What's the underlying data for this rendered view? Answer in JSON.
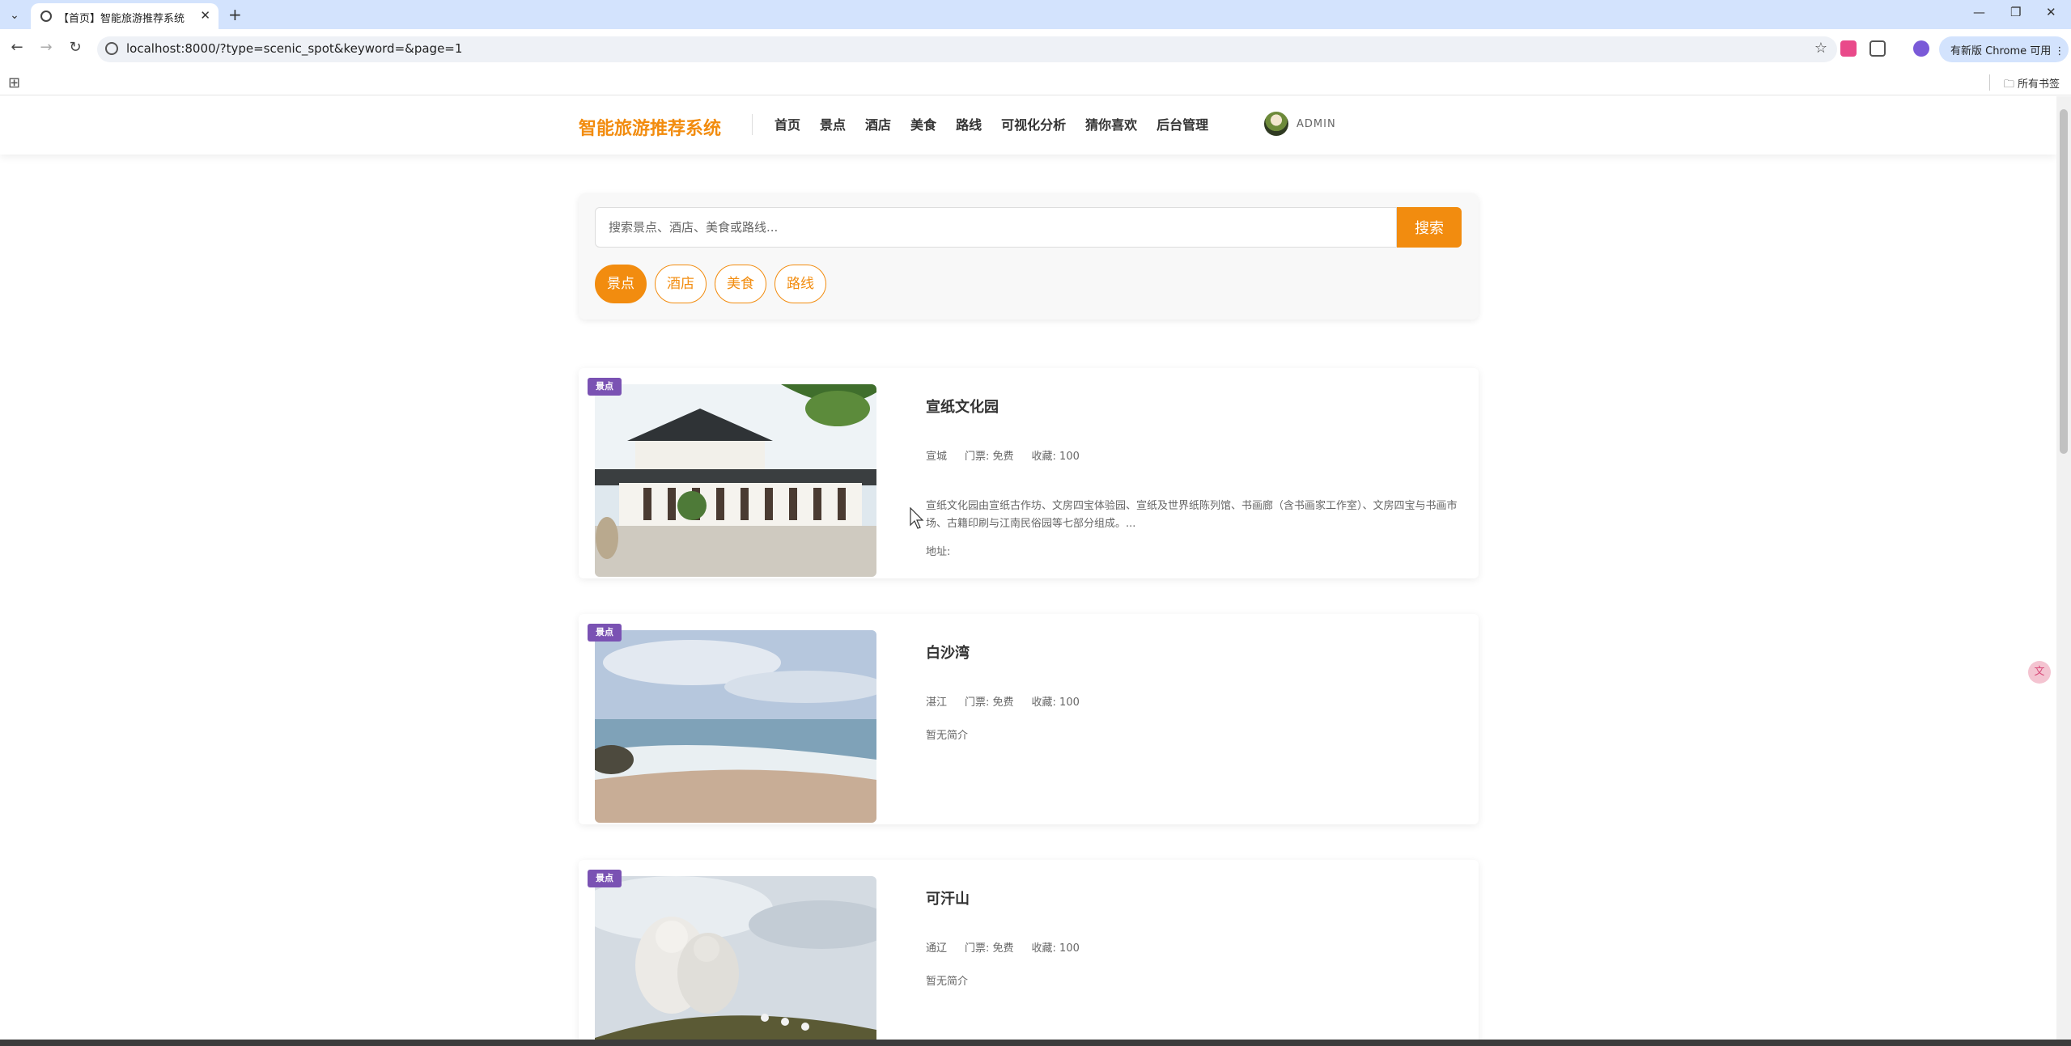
{
  "browser": {
    "tab_title": "【首页】智能旅游推荐系统",
    "url": "localhost:8000/?type=scenic_spot&keyword=&page=1",
    "update_label": "有新版 Chrome 可用",
    "all_bookmarks": "所有书签",
    "icons": [
      "tab-search-icon",
      "back-icon",
      "forward-icon",
      "reload-icon",
      "site-info-icon",
      "bookmark-star-icon",
      "extensions-icon",
      "profile-icon",
      "apps-grid-icon",
      "folder-icon"
    ]
  },
  "header": {
    "logo": "智能旅游推荐系统",
    "nav": [
      "首页",
      "景点",
      "酒店",
      "美食",
      "路线",
      "可视化分析",
      "猜你喜欢",
      "后台管理"
    ],
    "username": "ADMIN"
  },
  "search": {
    "placeholder": "搜索景点、酒店、美食或路线...",
    "button": "搜索",
    "filters": [
      "景点",
      "酒店",
      "美食",
      "路线"
    ],
    "active_filter": "景点"
  },
  "results": [
    {
      "badge": "景点",
      "title": "宣纸文化园",
      "city": "宣城",
      "ticket": "门票: 免费",
      "favorites": "收藏: 100",
      "description": "宣纸文化园由宣纸古作坊、文房四宝体验园、宣纸及世界纸陈列馆、书画廊（含书画家工作室）、文房四宝与书画市场、古籍印刷与江南民俗园等七部分组成。...",
      "address": "地址:"
    },
    {
      "badge": "景点",
      "title": "白沙湾",
      "city": "湛江",
      "ticket": "门票: 免费",
      "favorites": "收藏: 100",
      "description": "暂无简介"
    },
    {
      "badge": "景点",
      "title": "可汗山",
      "city": "通辽",
      "ticket": "门票: 免费",
      "favorites": "收藏: 100",
      "description": "暂无简介"
    }
  ],
  "colors": {
    "accent": "#f28c0f",
    "badge": "#7a52b3",
    "chrome_tabstrip": "#d3e3fd"
  }
}
